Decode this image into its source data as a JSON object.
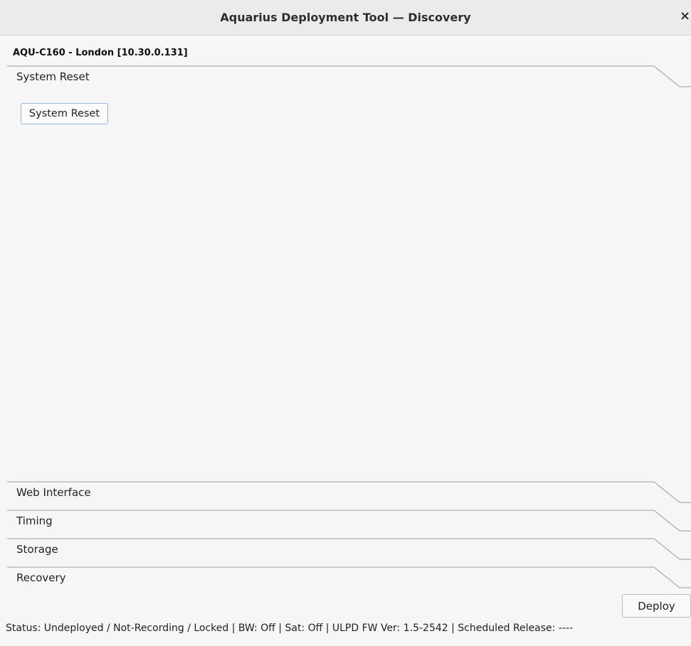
{
  "window": {
    "title": "Aquarius Deployment Tool — Discovery",
    "close_glyph": "×"
  },
  "device": {
    "label": "AQU-C160 - London [10.30.0.131]"
  },
  "sections": [
    {
      "label": "System Reset",
      "expanded": true
    },
    {
      "label": "Web Interface",
      "expanded": false
    },
    {
      "label": "Timing",
      "expanded": false
    },
    {
      "label": "Storage",
      "expanded": false
    },
    {
      "label": "Recovery",
      "expanded": false
    }
  ],
  "system_reset_panel": {
    "button_label": "System Reset"
  },
  "footer": {
    "deploy_label": "Deploy",
    "status": "Status: Undeployed / Not-Recording / Locked | BW: Off | Sat: Off | ULPD FW Ver: 1.5-2542 | Scheduled Release: ----"
  },
  "colors": {
    "titlebar_bg": "#ebebeb",
    "window_bg": "#f6f6f6",
    "header_line": "#9a9a9a",
    "button_focus_border": "#9bb4d6"
  }
}
